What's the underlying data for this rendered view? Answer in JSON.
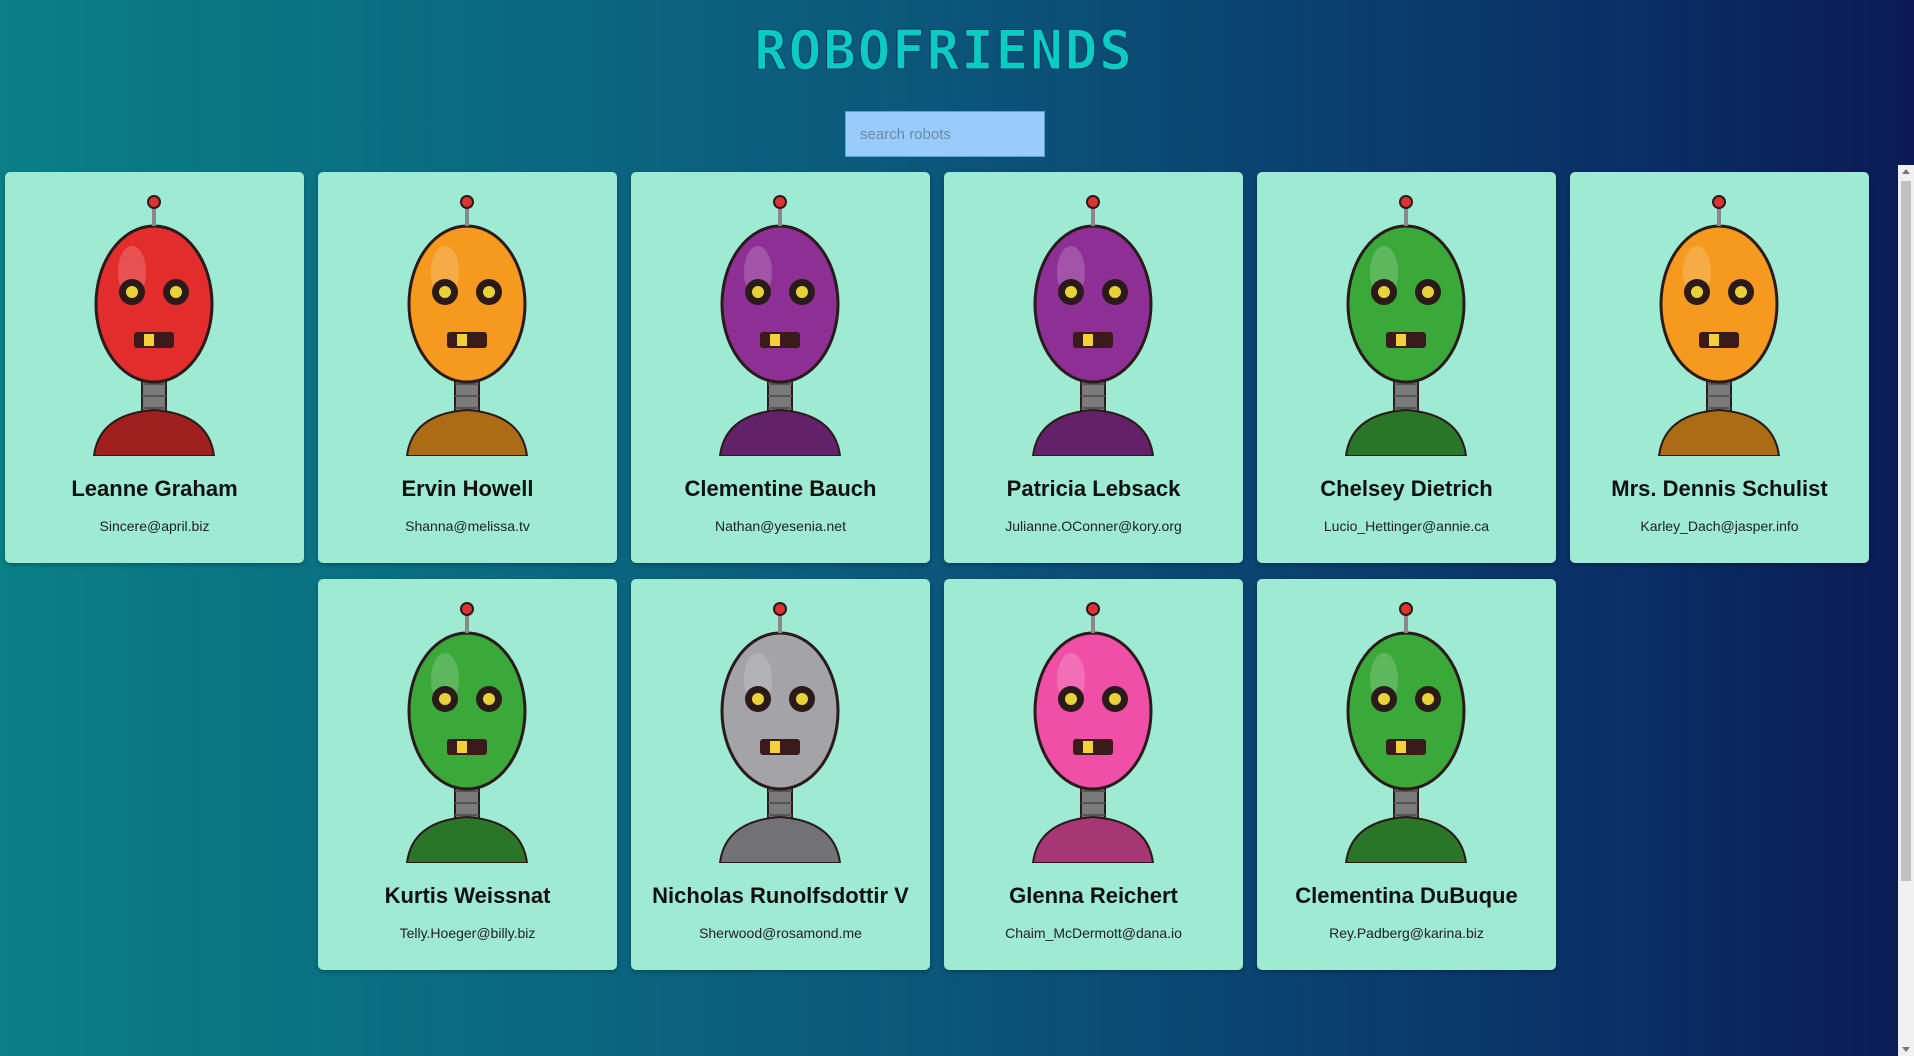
{
  "header": {
    "title": "ROBOFRIENDS"
  },
  "search": {
    "placeholder": "search robots",
    "value": ""
  },
  "robots": [
    {
      "name": "Leanne Graham",
      "email": "Sincere@april.biz",
      "color": "#e32c2c"
    },
    {
      "name": "Ervin Howell",
      "email": "Shanna@melissa.tv",
      "color": "#f59a1e"
    },
    {
      "name": "Clementine Bauch",
      "email": "Nathan@yesenia.net",
      "color": "#8e2f96"
    },
    {
      "name": "Patricia Lebsack",
      "email": "Julianne.OConner@kory.org",
      "color": "#8e2f96"
    },
    {
      "name": "Chelsey Dietrich",
      "email": "Lucio_Hettinger@annie.ca",
      "color": "#3aa93a"
    },
    {
      "name": "Mrs. Dennis Schulist",
      "email": "Karley_Dach@jasper.info",
      "color": "#f59a1e"
    },
    {
      "name": "Kurtis Weissnat",
      "email": "Telly.Hoeger@billy.biz",
      "color": "#3aa93a"
    },
    {
      "name": "Nicholas Runolfsdottir V",
      "email": "Sherwood@rosamond.me",
      "color": "#a3a3a8"
    },
    {
      "name": "Glenna Reichert",
      "email": "Chaim_McDermott@dana.io",
      "color": "#ef4fa6"
    },
    {
      "name": "Clementina DuBuque",
      "email": "Rey.Padberg@karina.biz",
      "color": "#3aa93a"
    }
  ]
}
